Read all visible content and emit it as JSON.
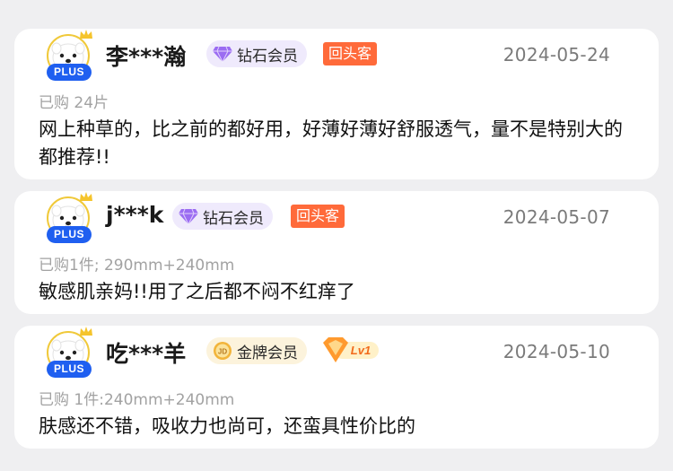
{
  "reviews": [
    {
      "username": "李***瀚",
      "plus_label": "PLUS",
      "membership": "钻石会员",
      "membership_icon": "diamond-icon",
      "tag": "回头客",
      "date": "2024-05-24",
      "spec": "已购 24片",
      "text": "网上种草的，比之前的都好用，好薄好薄好舒服透气，量不是特别大的都推荐!!"
    },
    {
      "username": "j***k",
      "plus_label": "PLUS",
      "membership": "钻石会员",
      "membership_icon": "diamond-icon",
      "tag": "回头客",
      "date": "2024-05-07",
      "spec": "已购1件; 290mm+240mm",
      "text": "敏感肌亲妈!!用了之后都不闷不红痒了"
    },
    {
      "username": "吃***羊",
      "plus_label": "PLUS",
      "membership": "金牌会员",
      "membership_icon": "jd-gold-icon",
      "level_badge": "Lv1",
      "date": "2024-05-10",
      "spec": "已购 1件:240mm+240mm",
      "text": "肤感还不错，吸收力也尚可，还蛮具性价比的"
    }
  ],
  "colors": {
    "plus_blue": "#1f5ff0",
    "tag_orange": "#ff6a3a",
    "diamond_bg": "#efeafc",
    "gold_bg": "#fcf3dc",
    "page_bg": "#efeff1"
  }
}
